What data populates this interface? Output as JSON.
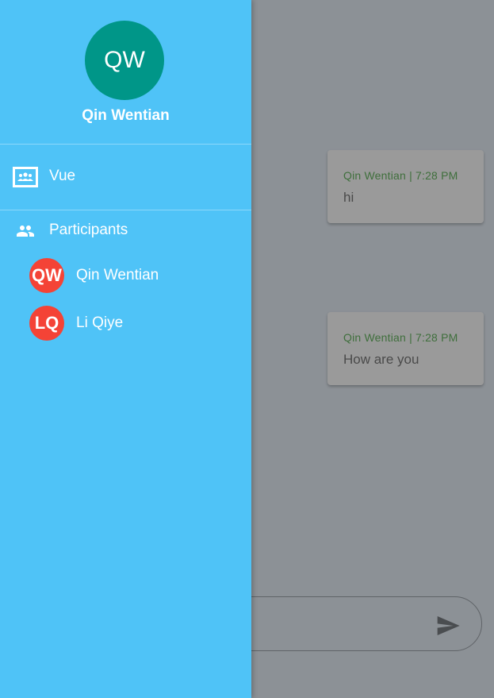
{
  "header": {
    "initials": "QW",
    "name": "Qin Wentian",
    "avatar_color": "#009688"
  },
  "nav": {
    "vue_label": "Vue",
    "participants_label": "Participants"
  },
  "participants": [
    {
      "initials": "QW",
      "name": "Qin Wentian"
    },
    {
      "initials": "LQ",
      "name": "Li Qiye"
    }
  ],
  "messages": [
    {
      "meta": "Qin Wentian | 7:28 PM",
      "text": "hi"
    },
    {
      "meta": "Qin Wentian | 7:28 PM",
      "text": "How are you"
    }
  ],
  "colors": {
    "drawer": "#4fc3f7",
    "participant_avatar": "#f44336",
    "overlay": "#8c9196"
  },
  "icons": {
    "vue": "group-screen-icon",
    "participants": "people-icon",
    "send": "send-icon"
  }
}
